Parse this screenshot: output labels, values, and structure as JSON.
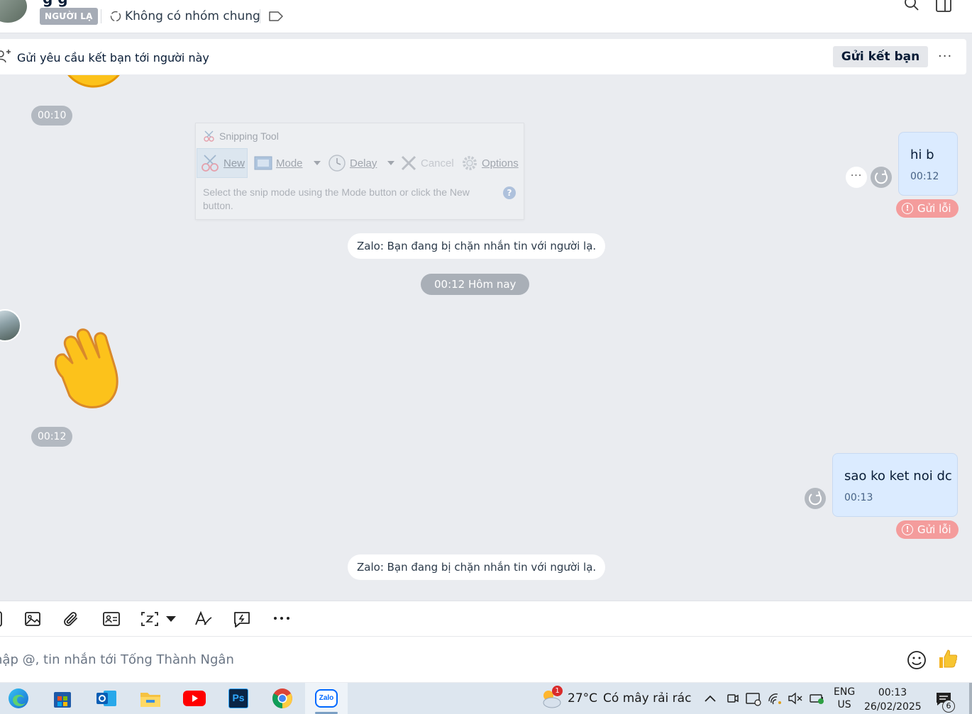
{
  "header": {
    "title_partial": "g  g",
    "stranger_badge": "NGƯỜI LẠ",
    "group_text": "Không có nhóm chung",
    "icons": [
      "avatar",
      "refresh-group-icon",
      "label-tag-icon",
      "search-icon",
      "layout-panel-icon"
    ]
  },
  "friend_request": {
    "text": "Gửi yêu cầu kết bạn tới người này",
    "button": "Gửi kết bạn",
    "more": "···"
  },
  "chat": {
    "time_1": "00:10",
    "time_2": "00:12",
    "notice_1": "Zalo: Bạn đang bị chặn nhắn tin với người lạ.",
    "notice_2": "Zalo: Bạn đang bị chặn nhắn tin với người lạ.",
    "date_divider": "00:12 Hôm nay",
    "sent": [
      {
        "text": "hi b",
        "time": "00:12",
        "status": "Gửi lỗi"
      },
      {
        "text": "sao ko ket noi dc",
        "time": "00:13",
        "status": "Gửi lỗi"
      }
    ],
    "more_button": "···"
  },
  "snipping_tool": {
    "title": "Snipping Tool",
    "new_label": "New",
    "mode_label": "Mode",
    "delay_label": "Delay",
    "cancel_label": "Cancel",
    "options_label": "Options",
    "help_text": "Select the snip mode using the Mode button or click the New button.",
    "help_icon": "?"
  },
  "composer": {
    "placeholder": "hập @, tin nhắn tới Tống Thành Ngân",
    "more": "···"
  },
  "taskbar": {
    "weather_badge": "1",
    "weather_temp": "27°C",
    "weather_desc": "Có mây rải rác",
    "lang_top": "ENG",
    "lang_bottom": "US",
    "time": "00:13",
    "date": "26/02/2025",
    "notification_count": "6",
    "zalo_label": "Zalo",
    "photoshop_label": "Ps"
  },
  "colors": {
    "bubble": "#dbebff",
    "error": "#f49c9c",
    "chat_bg": "#eaecf0",
    "pill": "#b3b9c1"
  }
}
